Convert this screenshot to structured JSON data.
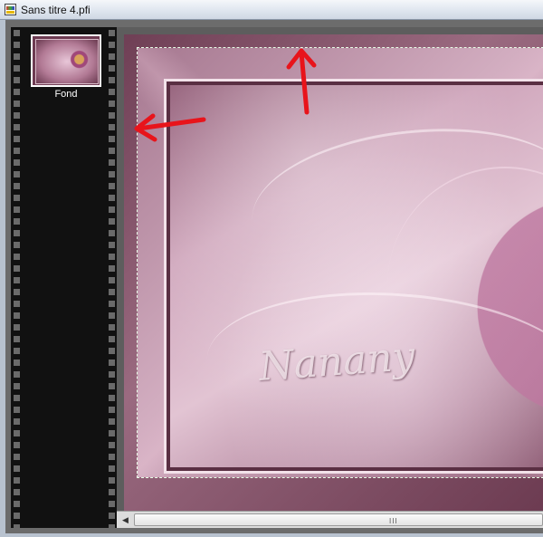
{
  "window": {
    "title": "Sans titre 4.pfi",
    "icon": "psp-file-icon"
  },
  "layers_panel": {
    "items": [
      {
        "label": "Fond",
        "selected": true
      }
    ]
  },
  "canvas": {
    "watermark_text": "Nanany",
    "annotations": [
      "red-arrow-up",
      "red-arrow-left"
    ],
    "arrow_color": "#e8141b"
  },
  "scrollbar": {
    "left_arrow": "◀",
    "grip": "III"
  }
}
